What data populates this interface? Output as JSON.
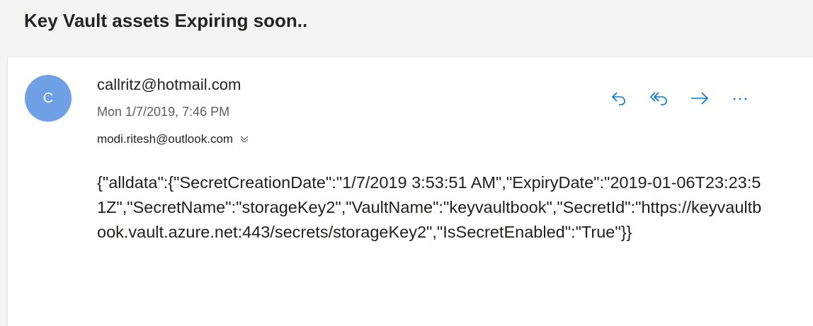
{
  "email": {
    "subject": "Key Vault assets Expiring soon..",
    "avatar_initial": "C",
    "avatar_color": "#6fa0e6",
    "sender": "callritz@hotmail.com",
    "date": "Mon 1/7/2019, 7:46 PM",
    "recipient": "modi.ritesh@outlook.com",
    "body": "{\"alldata\":{\"SecretCreationDate\":\"1/7/2019 3:53:51 AM\",\"ExpiryDate\":\"2019-01-06T23:23:51Z\",\"SecretName\":\"storageKey2\",\"VaultName\":\"keyvaultbook\",\"SecretId\":\"https://keyvaultbook.vault.azure.net:443/secrets/storageKey2\",\"IsSecretEnabled\":\"True\"}}"
  },
  "actions": {
    "reply_icon": "reply-icon",
    "reply_all_icon": "reply-all-icon",
    "forward_icon": "forward-icon",
    "more_icon": "more-actions-icon",
    "accent_color": "#0078d4"
  }
}
